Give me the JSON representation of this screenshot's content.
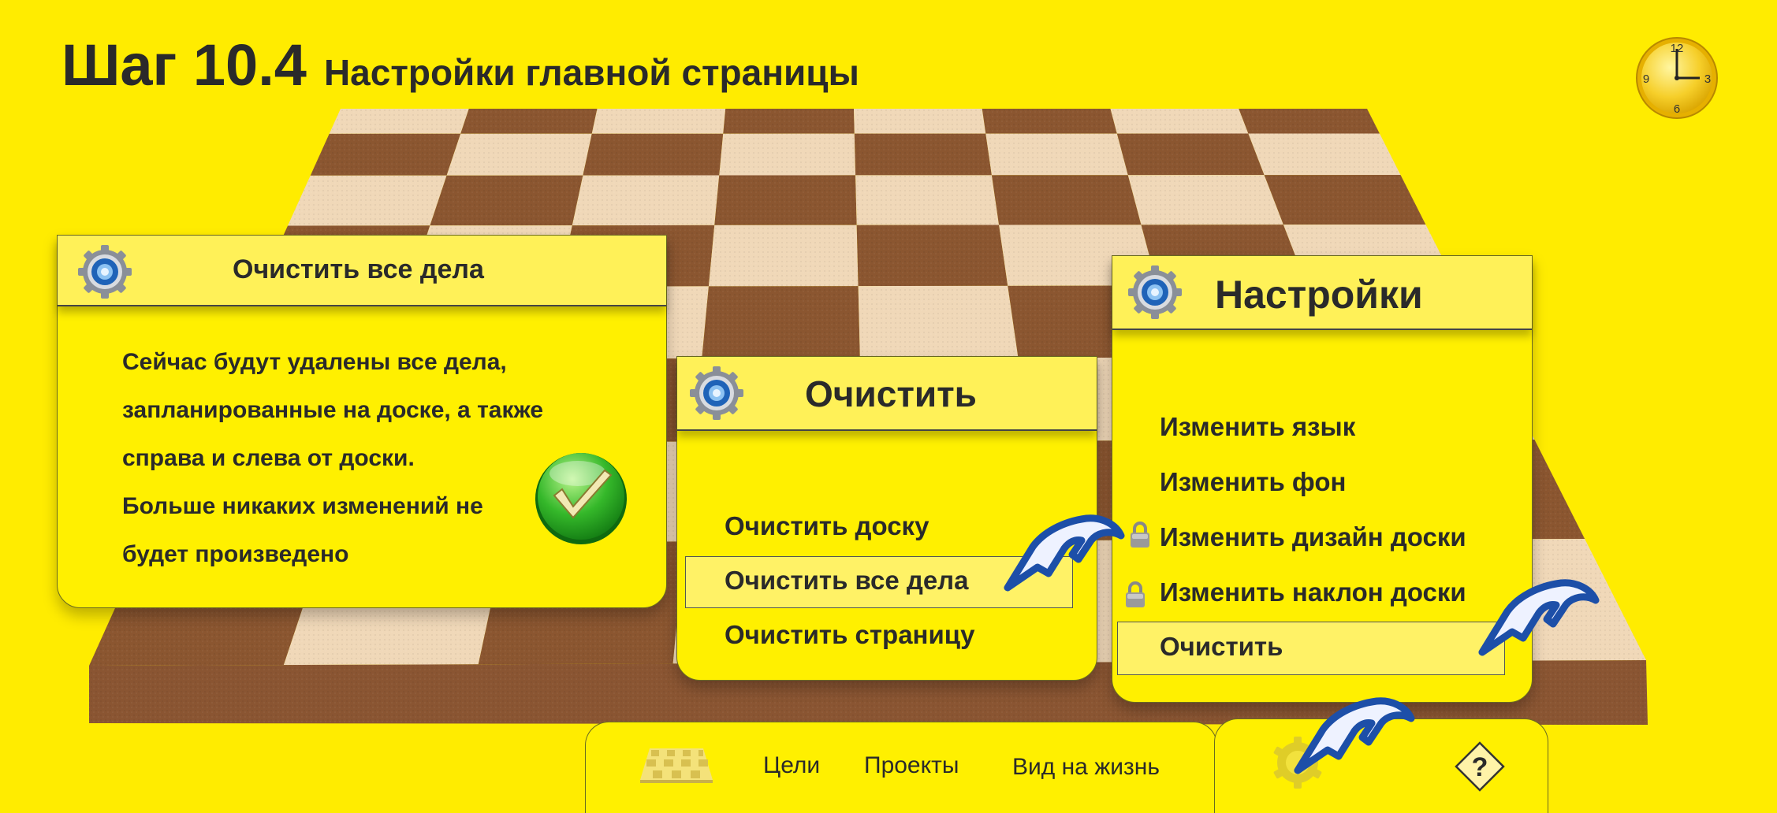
{
  "header": {
    "step": "Шаг 10.4",
    "subtitle": "Настройки главной страницы"
  },
  "clock": {
    "numbers": [
      "12",
      "3",
      "6",
      "9"
    ]
  },
  "clear_all_dialog": {
    "title": "Очистить все дела",
    "lines": [
      "Сейчас будут удалены все дела,",
      "запланированные на доске, а также",
      "справа и слева от доски.",
      "Больше никаких изменений не",
      "будет произведено"
    ]
  },
  "clear_menu": {
    "title": "Очистить",
    "items": [
      "Очистить доску",
      "Очистить все дела",
      "Очистить страницу"
    ]
  },
  "settings_menu": {
    "title": "Настройки",
    "items": [
      "Изменить язык",
      "Изменить фон",
      "Изменить дизайн доски",
      "Изменить наклон доски",
      "Очистить"
    ]
  },
  "bottom_nav": {
    "items": [
      "Цели",
      "Проекты",
      "Вид на жизнь"
    ],
    "help": "?"
  }
}
